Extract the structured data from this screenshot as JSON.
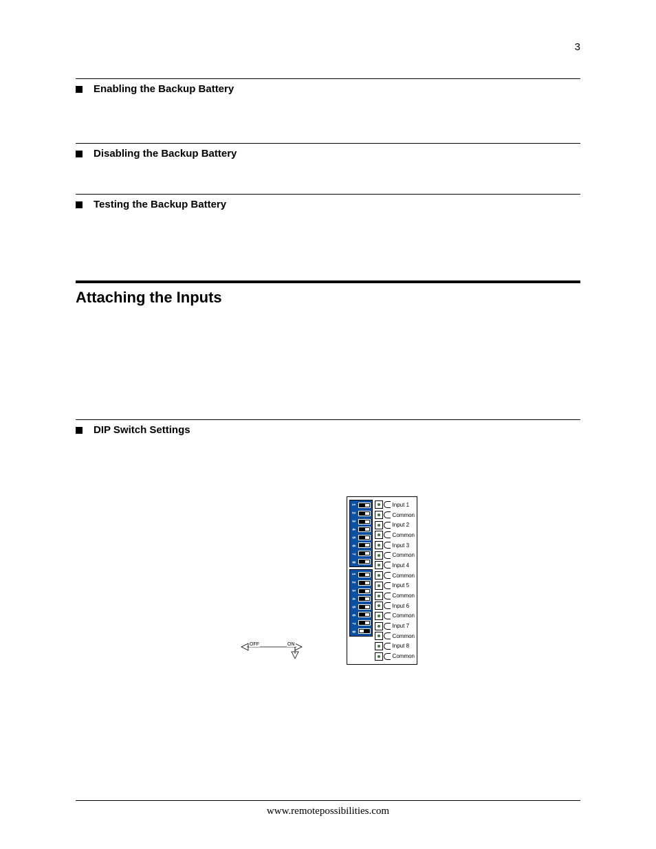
{
  "page_number": "3",
  "sections": [
    {
      "label": "Enabling the Backup Battery"
    },
    {
      "label": "Disabling the Backup Battery"
    },
    {
      "label": "Testing the Backup Battery"
    }
  ],
  "main_heading": "Attaching the Inputs",
  "sub_section": {
    "label": "DIP Switch Settings"
  },
  "figure": {
    "off_label": "OFF",
    "on_label": "ON",
    "dip_numbers_top": [
      "1",
      "2",
      "3",
      "4",
      "5",
      "6",
      "7",
      "8"
    ],
    "dip_numbers_bottom": [
      "1",
      "2",
      "3",
      "4",
      "5",
      "6",
      "7",
      "8"
    ],
    "terminals": [
      "Input 1",
      "Common",
      "Input 2",
      "Common",
      "Input 3",
      "Common",
      "Input 4",
      "Common",
      "Input 5",
      "Common",
      "Input 6",
      "Common",
      "Input 7",
      "Common",
      "Input 8",
      "Common"
    ]
  },
  "footer_url": "www.remotepossibilities.com"
}
